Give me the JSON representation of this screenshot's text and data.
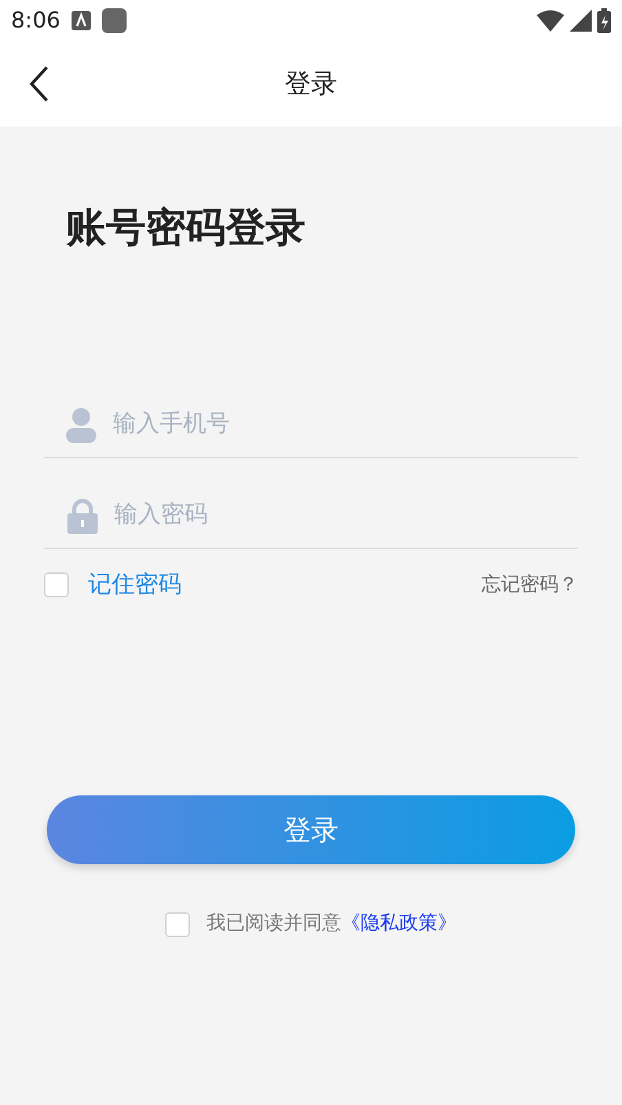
{
  "status_bar": {
    "time": "8:06"
  },
  "header": {
    "title": "登录"
  },
  "heading": "账号密码登录",
  "phone_field": {
    "placeholder": "输入手机号"
  },
  "password_field": {
    "placeholder": "输入密码"
  },
  "remember": {
    "label": "记住密码",
    "checked": false
  },
  "forgot_link": "忘记密码？",
  "login_button": "登录",
  "agreement": {
    "checked": false,
    "text": "我已阅读并同意",
    "link": "《隐私政策》"
  }
}
